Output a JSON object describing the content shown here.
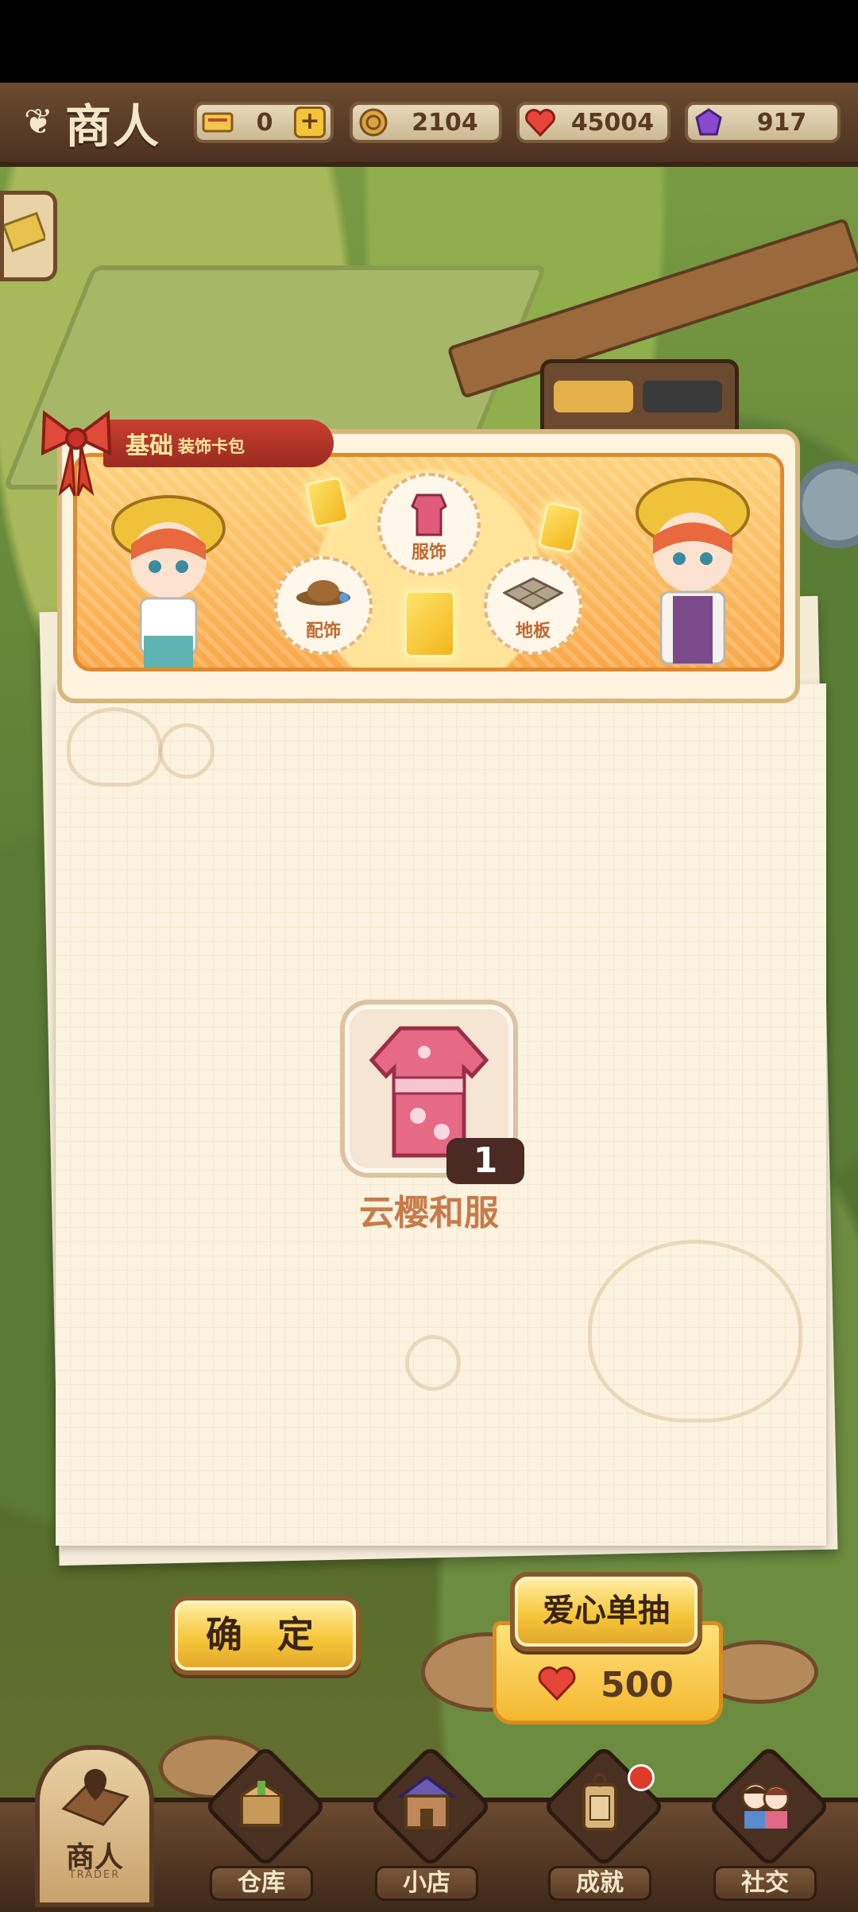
{
  "header": {
    "title": "商人",
    "resources": [
      {
        "name": "ticket",
        "value": "0",
        "has_plus": true
      },
      {
        "name": "coin",
        "value": "2104"
      },
      {
        "name": "heart",
        "value": "45004"
      },
      {
        "name": "gem",
        "value": "917"
      }
    ]
  },
  "banner": {
    "title_main": "基础",
    "title_sub": "装饰卡包",
    "categories": [
      "服饰",
      "配饰",
      "地板"
    ]
  },
  "reward": {
    "item_name": "云樱和服",
    "quantity": "1"
  },
  "buttons": {
    "confirm": "确 定",
    "single_draw": "爱心单抽",
    "draw_cost": "500"
  },
  "nav": {
    "active": {
      "label": "商人",
      "sub": "TRADER"
    },
    "items": [
      "仓库",
      "小店",
      "成就",
      "社交"
    ]
  },
  "colors": {
    "heart": "#e8453a",
    "gold": "#f6c73a",
    "wood": "#6b4a30"
  }
}
